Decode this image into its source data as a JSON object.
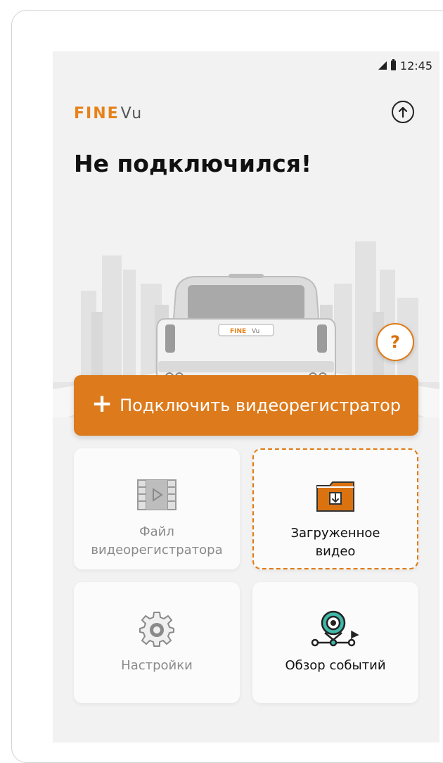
{
  "status_bar": {
    "time": "12:45"
  },
  "logo": {
    "part1": "FINE",
    "part2": "Vu"
  },
  "header": {
    "title": "Не подключился!"
  },
  "hero": {
    "car_plate_fine": "FINE",
    "car_plate_vu": "Vu"
  },
  "help": {
    "label": "?"
  },
  "connect": {
    "plus": "+",
    "label": "Подключить видеорегистратор"
  },
  "tiles": [
    {
      "id": "file",
      "line1": "Файл",
      "line2": "видеорегистратора",
      "icon": "film-icon",
      "enabled": false
    },
    {
      "id": "downloaded",
      "line1": "Загруженное",
      "line2": "видео",
      "icon": "folder-download-icon",
      "enabled": true
    },
    {
      "id": "settings",
      "line1": "Настройки",
      "line2": "",
      "icon": "gear-icon",
      "enabled": false
    },
    {
      "id": "events",
      "line1": "Обзор событий",
      "line2": "",
      "icon": "event-route-icon",
      "enabled": true
    }
  ],
  "colors": {
    "accent": "#dc7a1c",
    "background": "#f2f2f2",
    "teal": "#3fb8a8"
  }
}
